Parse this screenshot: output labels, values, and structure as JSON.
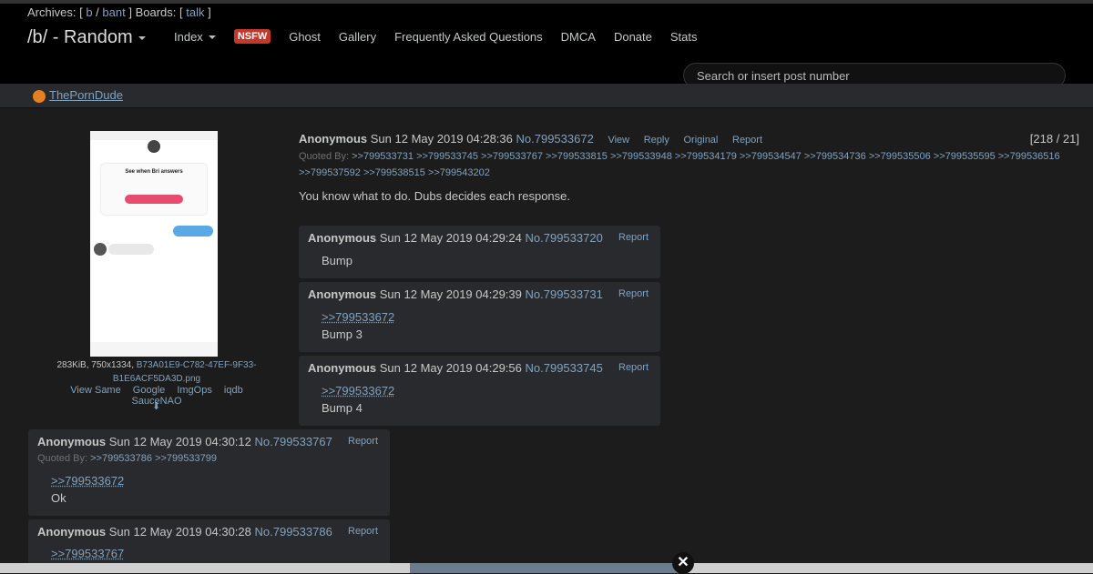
{
  "header": {
    "archives_label": "Archives: [",
    "archives_b": "b",
    "archives_sep": "/",
    "archives_bant": "bant",
    "boards_label": "] Boards: [",
    "boards_talk": "talk",
    "boards_end": "]",
    "board_title": "/b/ - Random",
    "nav": {
      "index": "Index",
      "nsfw": "NSFW",
      "ghost": "Ghost",
      "gallery": "Gallery",
      "faq": "Frequently Asked Questions",
      "dmca": "DMCA",
      "donate": "Donate",
      "stats": "Stats"
    },
    "search_placeholder": "Search or insert post number"
  },
  "ad": {
    "link": "ThePornDude"
  },
  "thumbnail": {
    "card_title": "See when Bri answers",
    "file_size": "283KiB, 750x1334,",
    "file_name": "B73A01E9-C782-47EF-9F33-B1E6ACF5DA3D.png",
    "links": [
      "View Same",
      "Google",
      "ImgOps",
      "iqdb",
      "SauceNAO"
    ],
    "download_icon": "⬇"
  },
  "op": {
    "name": "Anonymous",
    "date": "Sun 12 May 2019 04:28:36",
    "no": "No.799533672",
    "controls": {
      "view": "View",
      "reply": "Reply",
      "original": "Original",
      "report": "Report"
    },
    "counter": "[218 / 21]",
    "quoted_label": "Quoted By:",
    "quoted_links": ">>799533731 >>799533745 >>799533767 >>799533815 >>799533948 >>799534179 >>799534547 >>799534736 >>799535506 >>799535595 >>799536516 >>799537592 >>799538515 >>799543202",
    "text": "You know what to do. Dubs decides each response."
  },
  "replies": [
    {
      "name": "Anonymous",
      "date": "Sun 12 May 2019 04:29:24",
      "no": "No.799533720",
      "report": "Report",
      "text": "Bump"
    },
    {
      "name": "Anonymous",
      "date": "Sun 12 May 2019 04:29:39",
      "no": "No.799533731",
      "report": "Report",
      "quote": ">>799533672",
      "text": "Bump 3"
    },
    {
      "name": "Anonymous",
      "date": "Sun 12 May 2019 04:29:56",
      "no": "No.799533745",
      "report": "Report",
      "quote": ">>799533672",
      "text": "Bump 4"
    },
    {
      "name": "Anonymous",
      "date": "Sun 12 May 2019 04:30:12",
      "no": "No.799533767",
      "report": "Report",
      "quoted_label": "Quoted By:",
      "quoted_links": ">>799533786 >>799533799",
      "quote": ">>799533672",
      "text": "Ok"
    },
    {
      "name": "Anonymous",
      "date": "Sun 12 May 2019 04:30:28",
      "no": "No.799533786",
      "report": "Report",
      "quote": ">>799533767"
    }
  ],
  "overlay": {
    "close": "✕"
  }
}
